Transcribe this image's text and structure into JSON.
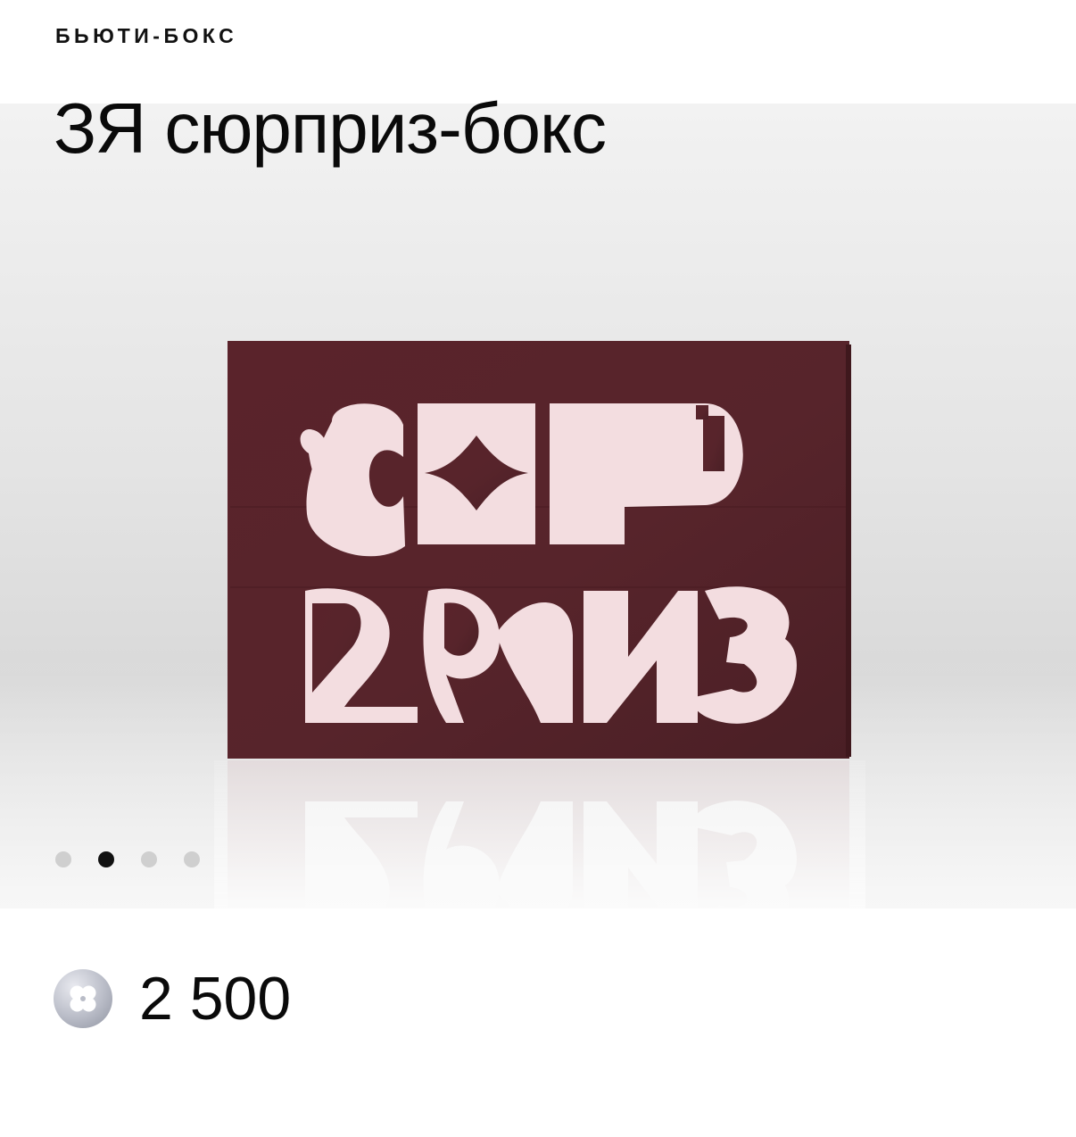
{
  "product": {
    "category": "БЬЮТИ-БОКС",
    "title": "ЗЯ сюрприз-бокс",
    "price": "2 500",
    "currency_icon": "clover-coin-icon"
  },
  "gallery": {
    "slide_count": 4,
    "active_slide": 2,
    "dots": [
      {
        "label": ""
      },
      {
        "label": ""
      },
      {
        "label": ""
      },
      {
        "label": ""
      }
    ]
  },
  "box_artwork": {
    "lettering_line1": "СЮР",
    "lettering_line2": "ПРИЗ",
    "box_color": "#5a232b",
    "letter_color": "#f3dde0"
  },
  "colors": {
    "text": "#0a0a0a",
    "dot_active": "#111111",
    "dot_inactive": "#cfcfcf"
  }
}
